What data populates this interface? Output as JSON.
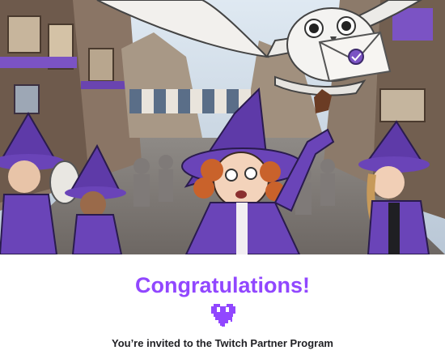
{
  "email": {
    "hero_image": "witch-school-illustration",
    "title": "Congratulations!",
    "icon": "glitch-heart-icon",
    "subtitle": "You’re invited to the Twitch Partner Program"
  },
  "colors": {
    "accent": "#9147ff",
    "text": "#1f1f23",
    "background": "#ffffff"
  }
}
